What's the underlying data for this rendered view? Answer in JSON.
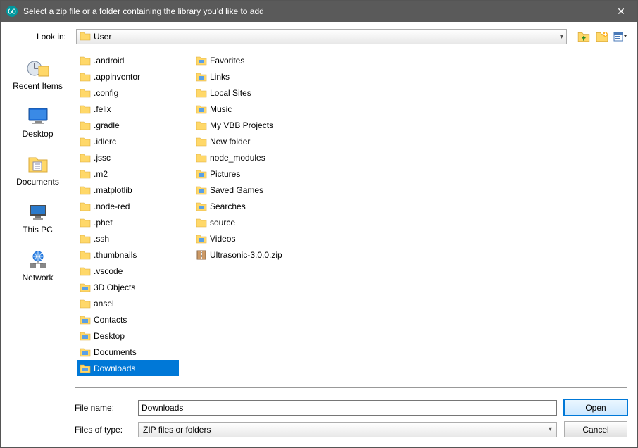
{
  "titlebar": {
    "title": "Select a zip file or a folder containing the library you'd like to add"
  },
  "toolbar": {
    "lookin_label": "Look in:",
    "lookin_value": "User"
  },
  "sidebar": {
    "items": [
      {
        "label": "Recent Items",
        "icon": "clock"
      },
      {
        "label": "Desktop",
        "icon": "desktop"
      },
      {
        "label": "Documents",
        "icon": "folder"
      },
      {
        "label": "This PC",
        "icon": "pc"
      },
      {
        "label": "Network",
        "icon": "network"
      }
    ]
  },
  "files": {
    "col1": [
      {
        "name": ".android",
        "icon": "folder"
      },
      {
        "name": ".appinventor",
        "icon": "folder"
      },
      {
        "name": ".config",
        "icon": "folder"
      },
      {
        "name": ".felix",
        "icon": "folder"
      },
      {
        "name": ".gradle",
        "icon": "folder"
      },
      {
        "name": ".idlerc",
        "icon": "folder"
      },
      {
        "name": ".jssc",
        "icon": "folder"
      },
      {
        "name": ".m2",
        "icon": "folder"
      },
      {
        "name": ".matplotlib",
        "icon": "folder"
      },
      {
        "name": ".node-red",
        "icon": "folder"
      },
      {
        "name": ".phet",
        "icon": "folder"
      },
      {
        "name": ".ssh",
        "icon": "folder"
      },
      {
        "name": ".thumbnails",
        "icon": "folder"
      },
      {
        "name": ".vscode",
        "icon": "folder"
      },
      {
        "name": "3D Objects",
        "icon": "folder-sys"
      },
      {
        "name": "ansel",
        "icon": "folder"
      },
      {
        "name": "Contacts",
        "icon": "folder-sys"
      },
      {
        "name": "Desktop",
        "icon": "folder-sys"
      },
      {
        "name": "Documents",
        "icon": "folder-sys"
      },
      {
        "name": "Downloads",
        "icon": "folder-sys",
        "selected": true
      },
      {
        "name": "Favorites",
        "icon": "folder-sys"
      }
    ],
    "col2": [
      {
        "name": "Links",
        "icon": "folder-sys"
      },
      {
        "name": "Local Sites",
        "icon": "folder"
      },
      {
        "name": "Music",
        "icon": "folder-sys"
      },
      {
        "name": "My VBB Projects",
        "icon": "folder"
      },
      {
        "name": "New folder",
        "icon": "folder"
      },
      {
        "name": "node_modules",
        "icon": "folder"
      },
      {
        "name": "Pictures",
        "icon": "folder-sys"
      },
      {
        "name": "Saved Games",
        "icon": "folder-sys"
      },
      {
        "name": "Searches",
        "icon": "folder-sys"
      },
      {
        "name": "source",
        "icon": "folder"
      },
      {
        "name": "Videos",
        "icon": "folder-sys"
      },
      {
        "name": "Ultrasonic-3.0.0.zip",
        "icon": "zip"
      }
    ]
  },
  "bottom": {
    "filename_label": "File name:",
    "filename_value": "Downloads",
    "filetype_label": "Files of type:",
    "filetype_value": "ZIP files or folders",
    "open_label": "Open",
    "cancel_label": "Cancel"
  }
}
